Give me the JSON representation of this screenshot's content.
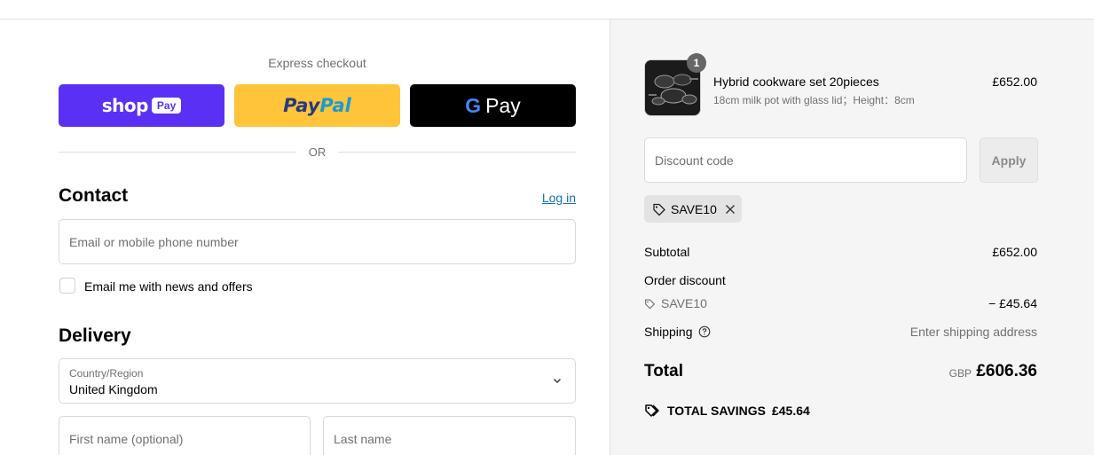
{
  "express": {
    "title": "Express checkout",
    "shop_pay": {
      "word": "shop",
      "pill": "Pay"
    },
    "paypal": {
      "part1": "Pay",
      "part2": "Pal"
    },
    "gpay": {
      "g": "G",
      "word": "Pay"
    },
    "or_label": "OR"
  },
  "contact": {
    "title": "Contact",
    "login_label": "Log in",
    "email_placeholder": "Email or mobile phone number",
    "newsletter_label": "Email me with news and offers",
    "newsletter_checked": false
  },
  "delivery": {
    "title": "Delivery",
    "country_label": "Country/Region",
    "country_value": "United Kingdom",
    "first_name_placeholder": "First name (optional)",
    "last_name_placeholder": "Last name"
  },
  "order": {
    "product": {
      "name": "Hybrid cookware set 20pieces",
      "variant": "18cm milk pot with glass lid；Height：8cm",
      "price": "£652.00",
      "quantity": "1"
    },
    "discount_placeholder": "Discount code",
    "apply_label": "Apply",
    "applied_code": "SAVE10",
    "summary": {
      "subtotal_label": "Subtotal",
      "subtotal_value": "£652.00",
      "order_discount_label": "Order discount",
      "discount_code": "SAVE10",
      "discount_value": "− £45.64",
      "shipping_label": "Shipping",
      "shipping_value": "Enter shipping address",
      "total_label": "Total",
      "total_currency": "GBP",
      "total_value": "£606.36",
      "savings_label": "TOTAL SAVINGS",
      "savings_value": "£45.64"
    }
  },
  "colors": {
    "shop_pay": "#5a31f4",
    "paypal": "#ffc439",
    "gpay": "#000000",
    "link": "#1773b0",
    "summary_bg": "#f5f5f5"
  }
}
